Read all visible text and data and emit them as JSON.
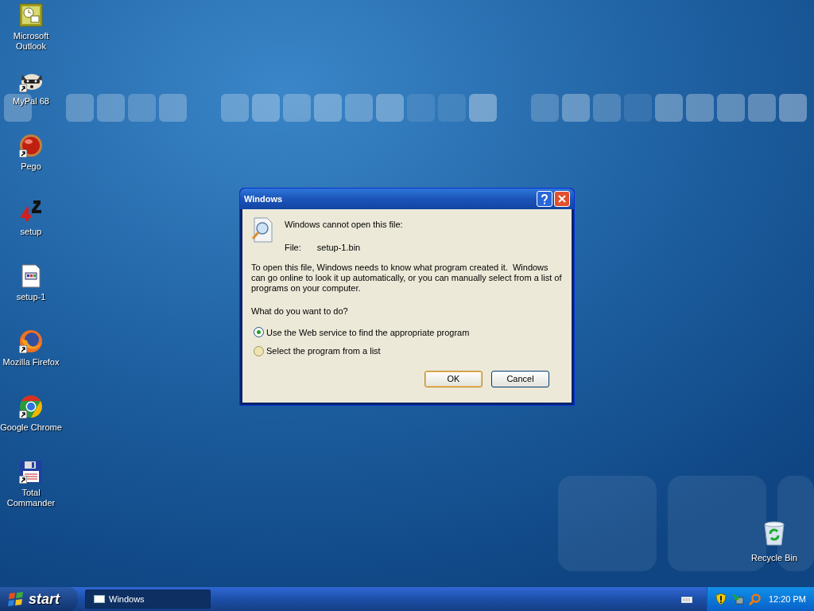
{
  "desktop_icons": [
    {
      "label": "Microsoft Outlook",
      "kind": "outlook",
      "shortcut": false
    },
    {
      "label": "MyPal 68",
      "kind": "raccoon",
      "shortcut": true
    },
    {
      "label": "Pego",
      "kind": "orb",
      "shortcut": true
    },
    {
      "label": "setup",
      "kind": "installer",
      "shortcut": false
    },
    {
      "label": "setup-1",
      "kind": "document",
      "shortcut": false
    },
    {
      "label": "Mozilla Firefox",
      "kind": "firefox",
      "shortcut": true
    },
    {
      "label": "Google Chrome",
      "kind": "chrome",
      "shortcut": true
    },
    {
      "label": "Total Commander",
      "kind": "floppy",
      "shortcut": true
    }
  ],
  "recycle_bin": {
    "label": "Recycle Bin"
  },
  "dialog": {
    "title": "Windows",
    "message": "Windows cannot open this file:",
    "file_label": "File:",
    "file_name": "setup-1.bin",
    "explanation": "To open this file, Windows needs to know what program created it.  Windows can go online to look it up automatically, or you can manually select from a list of programs on your computer.",
    "question": "What do you want to do?",
    "options": [
      {
        "label": "Use the Web service to find the appropriate program",
        "selected": true
      },
      {
        "label": "Select the program from a list",
        "selected": false
      }
    ],
    "buttons": [
      {
        "label": "OK",
        "default": true
      },
      {
        "label": "Cancel",
        "default": false
      }
    ]
  },
  "taskbar": {
    "start_label": "start",
    "tasks": [
      {
        "label": "Windows",
        "selected": true
      }
    ],
    "clock": "12:20 PM"
  }
}
